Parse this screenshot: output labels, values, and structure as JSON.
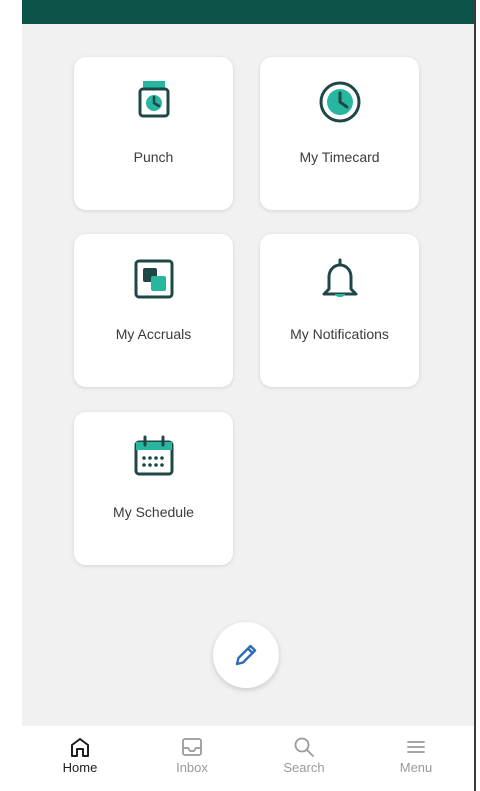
{
  "colors": {
    "header": "#0b5248",
    "accent": "#27b7a0",
    "icon_dark": "#1f4746",
    "edit_icon": "#2d6db5"
  },
  "tiles": [
    {
      "label": "Punch",
      "icon": "punch-clock-icon"
    },
    {
      "label": "My Timecard",
      "icon": "timecard-clock-icon"
    },
    {
      "label": "My Accruals",
      "icon": "accruals-icon"
    },
    {
      "label": "My Notifications",
      "icon": "bell-icon"
    },
    {
      "label": "My Schedule",
      "icon": "calendar-icon"
    }
  ],
  "fab": {
    "icon": "pencil-edit-icon"
  },
  "bottom_nav": [
    {
      "label": "Home",
      "icon": "home-icon",
      "active": true
    },
    {
      "label": "Inbox",
      "icon": "inbox-icon",
      "active": false
    },
    {
      "label": "Search",
      "icon": "search-icon",
      "active": false
    },
    {
      "label": "Menu",
      "icon": "menu-icon",
      "active": false
    }
  ]
}
